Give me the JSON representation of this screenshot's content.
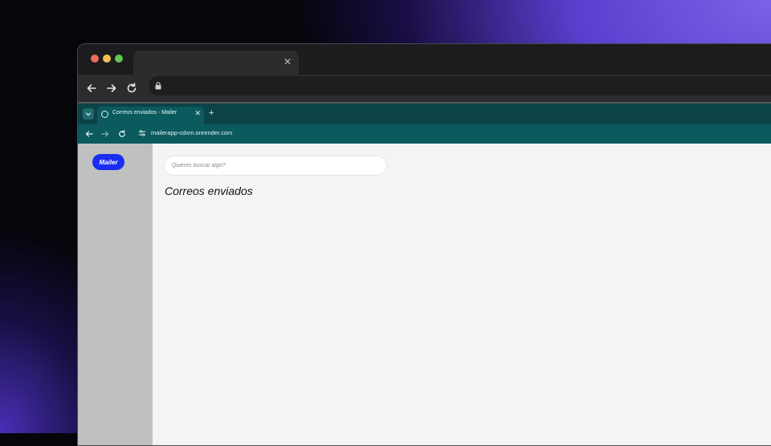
{
  "inner_browser": {
    "tab_title": "Correos enviados - Mailer",
    "url": "mailerapp-cdxm.onrender.com"
  },
  "app": {
    "logo": "Mailer",
    "search": {
      "placeholder": "Quieres buscar algo?",
      "value": ""
    },
    "page_title": "Correos enviados"
  },
  "colors": {
    "accent": "#1a2df0",
    "browser_chrome": "#0b5a5e",
    "sidebar": "#c0c0c0",
    "content_bg": "#f4f4f4"
  },
  "icons": [
    "close-icon",
    "back-arrow-icon",
    "forward-arrow-icon",
    "reload-icon",
    "lock-icon",
    "chevron-down-icon",
    "globe-icon",
    "plus-icon",
    "site-settings-icon"
  ]
}
